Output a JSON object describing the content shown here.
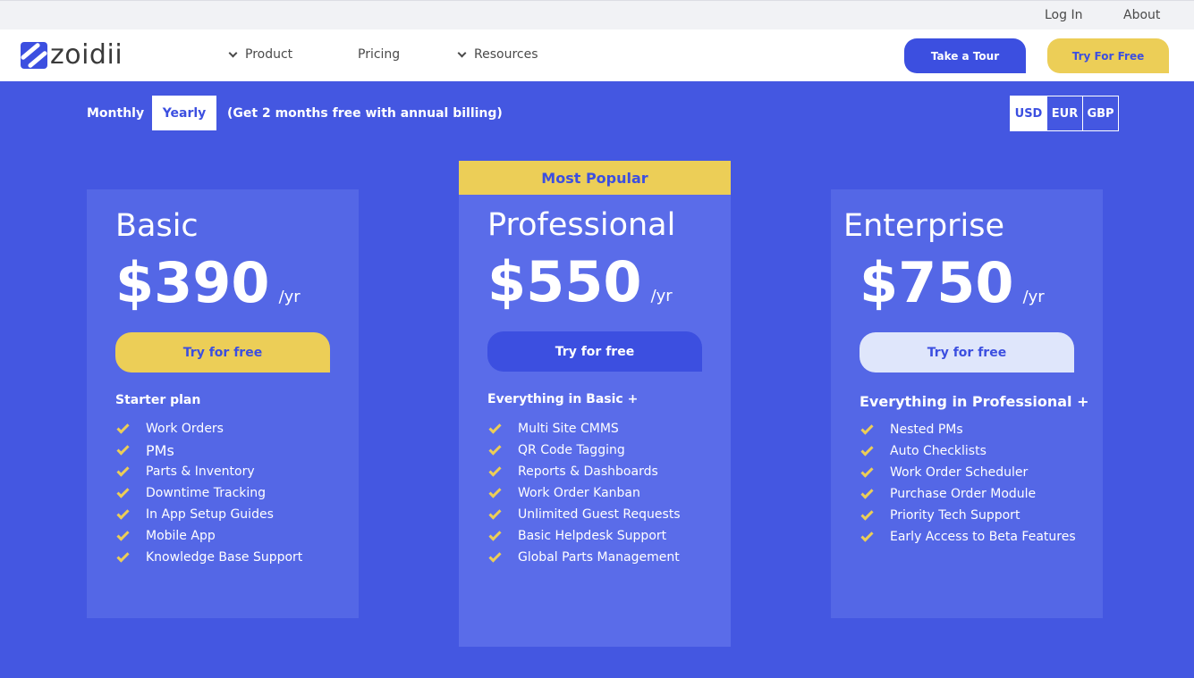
{
  "topbar": {
    "login": "Log In",
    "about": "About"
  },
  "nav": {
    "logo_text": "zoidii",
    "product": "Product",
    "pricing": "Pricing",
    "resources": "Resources",
    "tour_btn": "Take a Tour",
    "free_btn": "Try For Free"
  },
  "billing": {
    "monthly": "Monthly",
    "yearly": "Yearly",
    "note": "(Get 2 months free with annual billing)",
    "selected": "Yearly"
  },
  "currency": {
    "options": [
      "USD",
      "EUR",
      "GBP"
    ],
    "selected": "USD"
  },
  "popular_badge": "Most Popular",
  "plans": [
    {
      "name": "Basic",
      "price": "$390",
      "period": "/yr",
      "cta": "Try for free",
      "features_title": "Starter plan",
      "features": [
        "Work Orders",
        "PMs",
        "Parts & Inventory",
        "Downtime Tracking",
        "In App Setup Guides",
        "Mobile App",
        "Knowledge Base Support"
      ]
    },
    {
      "name": "Professional",
      "price": "$550",
      "period": "/yr",
      "cta": "Try for free",
      "features_title": "Everything in Basic +",
      "features": [
        "Multi Site CMMS",
        "QR Code Tagging",
        "Reports & Dashboards",
        "Work Order Kanban",
        "Unlimited Guest Requests",
        "Basic Helpdesk Support",
        "Global Parts Management"
      ]
    },
    {
      "name": "Enterprise",
      "price": "$750",
      "period": "/yr",
      "cta": "Try for free",
      "features_title": "Everything in Professional +",
      "features": [
        "Nested PMs",
        "Auto Checklists",
        "Work Order Scheduler",
        "Purchase Order Module",
        "Priority Tech Support",
        "Early Access to Beta Features"
      ]
    }
  ],
  "colors": {
    "brand_blue": "#4457e1",
    "accent_yellow": "#ecce57",
    "light_button": "#dfe6fb"
  }
}
